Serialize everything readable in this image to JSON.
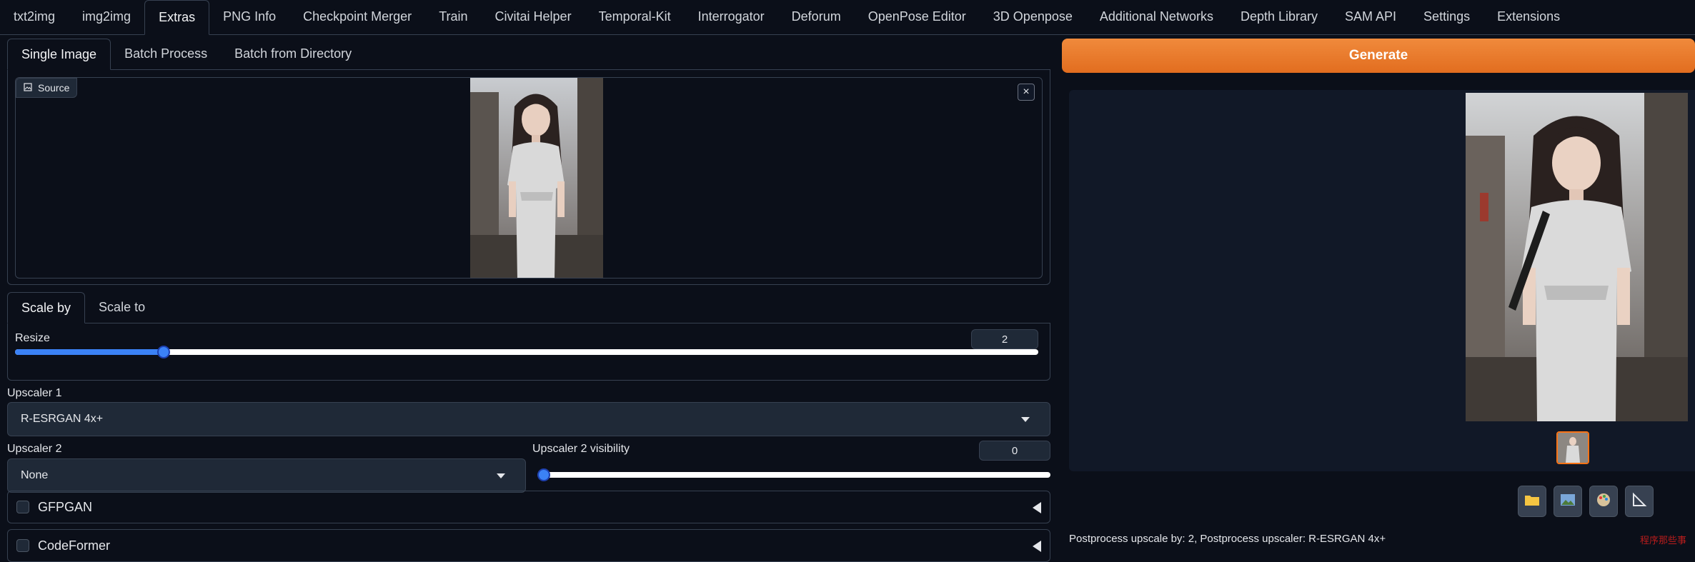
{
  "nav": {
    "tabs": [
      "txt2img",
      "img2img",
      "Extras",
      "PNG Info",
      "Checkpoint Merger",
      "Train",
      "Civitai Helper",
      "Temporal-Kit",
      "Interrogator",
      "Deforum",
      "OpenPose Editor",
      "3D Openpose",
      "Additional Networks",
      "Depth Library",
      "SAM API",
      "Settings",
      "Extensions"
    ],
    "active": "Extras"
  },
  "extras": {
    "tabs": [
      "Single Image",
      "Batch Process",
      "Batch from Directory"
    ],
    "source_label": "Source",
    "close_glyph": "×"
  },
  "scale": {
    "tabs": [
      "Scale by",
      "Scale to"
    ],
    "resize_label": "Resize",
    "resize_value": "2",
    "resize_fraction": 0.145
  },
  "upscaler1": {
    "label": "Upscaler 1",
    "value": "R-ESRGAN 4x+"
  },
  "upscaler2": {
    "label": "Upscaler 2",
    "value": "None",
    "visibility_label": "Upscaler 2 visibility",
    "visibility_value": "0",
    "visibility_fraction": 0.0
  },
  "gfpgan": {
    "label": "GFPGAN"
  },
  "codeformer": {
    "label": "CodeFormer"
  },
  "generate": {
    "label": "Generate"
  },
  "output": {
    "info": "Postprocess upscale by: 2, Postprocess upscaler: R-ESRGAN 4x+",
    "watermark": "程序那些事"
  },
  "icons": [
    "folder-icon",
    "image-icon",
    "palette-icon",
    "ruler-icon"
  ],
  "colors": {
    "accent": "#e8762c",
    "slider": "#3b82f6",
    "bg": "#0b0f19"
  }
}
